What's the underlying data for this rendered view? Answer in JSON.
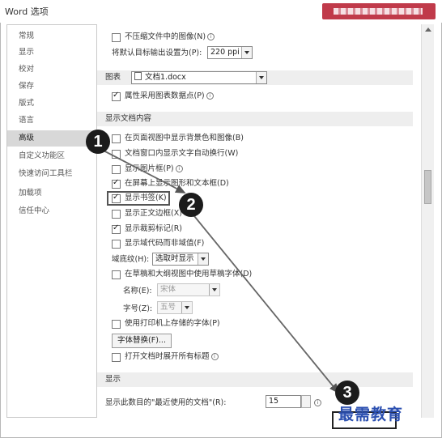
{
  "window": {
    "title": "Word 选项"
  },
  "sidebar": {
    "items": [
      {
        "label": "常规"
      },
      {
        "label": "显示"
      },
      {
        "label": "校对"
      },
      {
        "label": "保存"
      },
      {
        "label": "版式"
      },
      {
        "label": "语言"
      },
      {
        "label": "高级",
        "selected": true
      },
      {
        "label": "自定义功能区"
      },
      {
        "label": "快速访问工具栏"
      },
      {
        "label": "加载项"
      },
      {
        "label": "信任中心"
      }
    ]
  },
  "main": {
    "no_compress": {
      "label": "不压缩文件中的图像(N)",
      "checked": false
    },
    "default_output": {
      "label": "将默认目标输出设置为(P):",
      "value": "220 ppi"
    },
    "chart_section": {
      "title": "图表",
      "doc_name": "文档1.docx"
    },
    "chart_props": {
      "label": "属性采用图表数据点(P)",
      "checked": true
    },
    "display_section": {
      "title": "显示文档内容"
    },
    "options": [
      {
        "label": "在页面视图中显示背景色和图像(B)",
        "checked": false
      },
      {
        "label": "文档窗口内显示文字自动换行(W)",
        "checked": false
      },
      {
        "label": "显示图片框(P)",
        "checked": false
      },
      {
        "label": "在屏幕上显示图形和文本框(D)",
        "checked": true
      },
      {
        "label": "显示书签(K)",
        "checked": true
      },
      {
        "label": "显示正文边框(X)",
        "checked": false
      },
      {
        "label": "显示裁剪标记(R)",
        "checked": true
      },
      {
        "label": "显示域代码而非域值(F)",
        "checked": false
      }
    ],
    "field_shading": {
      "label": "域底纹(H):",
      "value": "选取时显示"
    },
    "draft_font": {
      "label": "在草稿和大纲视图中使用草稿字体(D)",
      "checked": false
    },
    "font_name": {
      "label": "名称(E):",
      "value": "宋体"
    },
    "font_size": {
      "label": "字号(Z):",
      "value": "五号"
    },
    "printer_fonts": {
      "label": "使用打印机上存储的字体(P)",
      "checked": false
    },
    "font_substitution": {
      "label": "字体替换(F)..."
    },
    "expand_headings": {
      "label": "打开文档时展开所有标题",
      "checked": false
    },
    "show_section": {
      "title": "显示"
    },
    "recent_docs": {
      "label": "显示此数目的\"最近使用的文档\"(R):",
      "value": "15"
    }
  },
  "annotations": {
    "step1": "1",
    "step2": "2",
    "step3": "3"
  },
  "watermark": {
    "text": "最需教育"
  },
  "colors": {
    "sidebar_selected": "#d8d8d8",
    "section_header": "#eeeeee",
    "watermark": "#2b4fb0",
    "banner": "#c03a4a"
  }
}
